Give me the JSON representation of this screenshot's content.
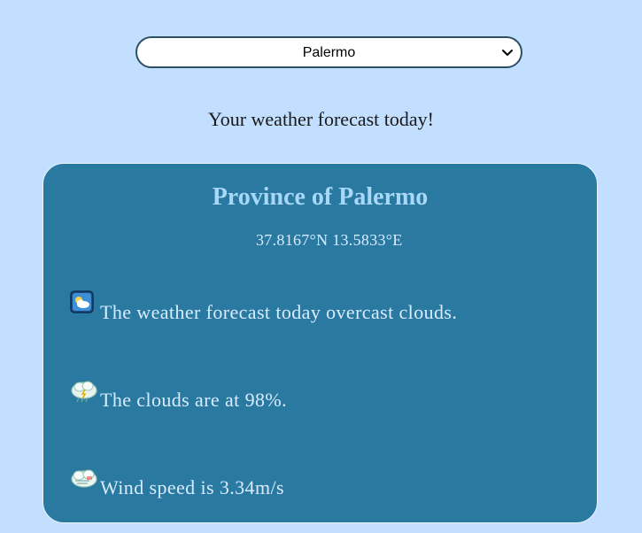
{
  "city_select": {
    "selected": "Palermo",
    "options": [
      "Palermo"
    ]
  },
  "headline": "Your weather forecast today!",
  "forecast": {
    "province_title": "Province of Palermo",
    "coordinates": "37.8167°N 13.5833°E",
    "weather_text": "The weather forecast today overcast clouds.",
    "weather_icon": "cloud-weather-icon",
    "clouds_text": "The clouds are at 98%.",
    "clouds_icon": "cloud-percentage-icon",
    "wind_text": "Wind speed is 3.34m/s",
    "wind_icon": "wind-speed-icon"
  },
  "colors": {
    "page_background": "#c3dfff",
    "card_background": "#2979a0",
    "title_color": "#a9d7f7",
    "text_color": "#d9ecff"
  }
}
